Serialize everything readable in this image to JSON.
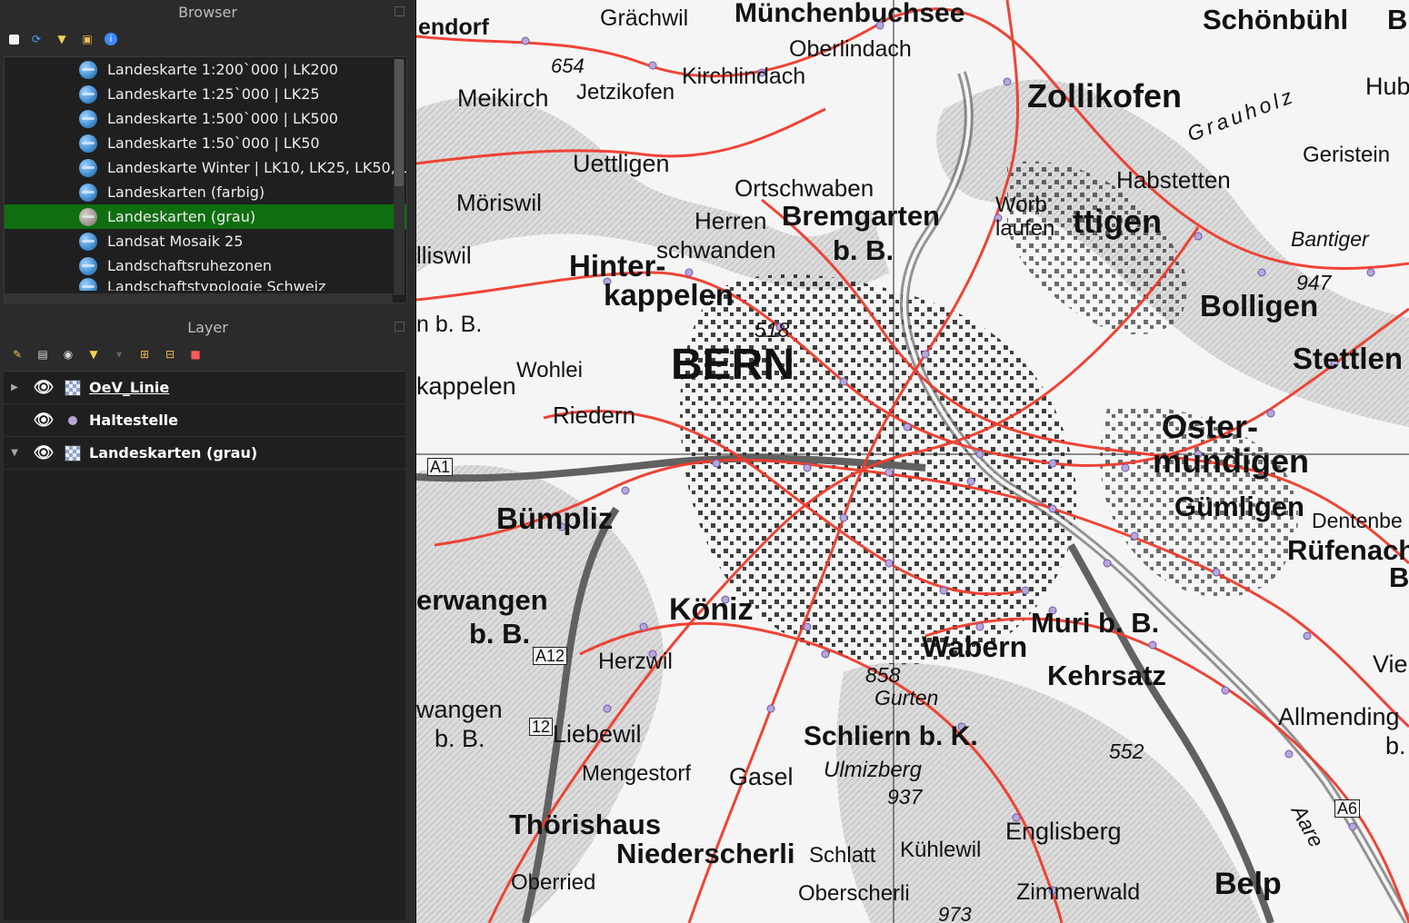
{
  "browser": {
    "title": "Browser",
    "items": [
      {
        "label": "Landeskarte 1:200`000 | LK200"
      },
      {
        "label": "Landeskarte 1:25`000 | LK25"
      },
      {
        "label": "Landeskarte 1:500`000 | LK500"
      },
      {
        "label": "Landeskarte 1:50`000 | LK50"
      },
      {
        "label": "Landeskarte Winter | LK10, LK25, LK50, L"
      },
      {
        "label": "Landeskarten (farbig)"
      },
      {
        "label": "Landeskarten (grau)"
      },
      {
        "label": "Landsat Mosaik 25"
      },
      {
        "label": "Landschaftsruhezonen"
      },
      {
        "label": "Landschaftstypologie Schweiz"
      }
    ]
  },
  "layers": {
    "title": "Layer",
    "items": [
      {
        "label": "OeV_Linie"
      },
      {
        "label": "Haltestelle"
      },
      {
        "label": "Landeskarten (grau)"
      }
    ]
  },
  "map": {
    "labels": [
      {
        "text": "endorf"
      },
      {
        "text": "Grächwil"
      },
      {
        "text": "Münchenbuchsee"
      },
      {
        "text": "Schönbühl"
      },
      {
        "text": "Oberlindach"
      },
      {
        "text": "654"
      },
      {
        "text": "Kirchlindach"
      },
      {
        "text": "Meikirch"
      },
      {
        "text": "Jetzikofen"
      },
      {
        "text": "Zollikofen"
      },
      {
        "text": "Grauholz"
      },
      {
        "text": "Hub"
      },
      {
        "text": "Geristein"
      },
      {
        "text": "Uettligen"
      },
      {
        "text": "Habstetten"
      },
      {
        "text": "Möriswil"
      },
      {
        "text": "Ortschwaben"
      },
      {
        "text": "Worb"
      },
      {
        "text": "laufen"
      },
      {
        "text": "ttigen"
      },
      {
        "text": "Herren"
      },
      {
        "text": "Bremgarten"
      },
      {
        "text": "schwanden"
      },
      {
        "text": "b. B."
      },
      {
        "text": "Bantiger"
      },
      {
        "text": "947"
      },
      {
        "text": "lliswil"
      },
      {
        "text": "Hinter-"
      },
      {
        "text": "kappelen"
      },
      {
        "text": "Bolligen"
      },
      {
        "text": "n b. B."
      },
      {
        "text": "518"
      },
      {
        "text": "BERN"
      },
      {
        "text": "Stettlen"
      },
      {
        "text": "Wohlei"
      },
      {
        "text": "kappelen"
      },
      {
        "text": "Riedern"
      },
      {
        "text": "Oster-"
      },
      {
        "text": "mundigen"
      },
      {
        "text": "A1"
      },
      {
        "text": "Bümpliz"
      },
      {
        "text": "Gümligen"
      },
      {
        "text": "Dentenbe"
      },
      {
        "text": "Rüfenach"
      },
      {
        "text": "erwangen"
      },
      {
        "text": "b. B."
      },
      {
        "text": "Köniz"
      },
      {
        "text": "Muri b. B."
      },
      {
        "text": "A12"
      },
      {
        "text": "Herzwil"
      },
      {
        "text": "Wabern"
      },
      {
        "text": "Vielb"
      },
      {
        "text": "858"
      },
      {
        "text": "Gurten"
      },
      {
        "text": "Kehrsatz"
      },
      {
        "text": "wangen"
      },
      {
        "text": "b. B."
      },
      {
        "text": "12"
      },
      {
        "text": "Liebewil"
      },
      {
        "text": "Allmending"
      },
      {
        "text": "b."
      },
      {
        "text": "Schliern b. K."
      },
      {
        "text": "552"
      },
      {
        "text": "Mengestorf"
      },
      {
        "text": "Gasel"
      },
      {
        "text": "Ulmizberg"
      },
      {
        "text": "937"
      },
      {
        "text": "A6"
      },
      {
        "text": "Aare"
      },
      {
        "text": "Thörishaus"
      },
      {
        "text": "Englisberg"
      },
      {
        "text": "Niederscherli"
      },
      {
        "text": "Schlatt"
      },
      {
        "text": "Kühlewil"
      },
      {
        "text": "Oberried"
      },
      {
        "text": "Oberscherli"
      },
      {
        "text": "Zimmerwald"
      },
      {
        "text": "Belp"
      },
      {
        "text": "973"
      },
      {
        "text": "BE"
      },
      {
        "text": "Bl"
      }
    ]
  },
  "colors": {
    "selection": "#0f6e0f",
    "route_line": "#ef3b2c",
    "stop_point": "#b8a6db",
    "panel_bg": "#2b2b2b",
    "tree_bg": "#1f1f1f"
  }
}
